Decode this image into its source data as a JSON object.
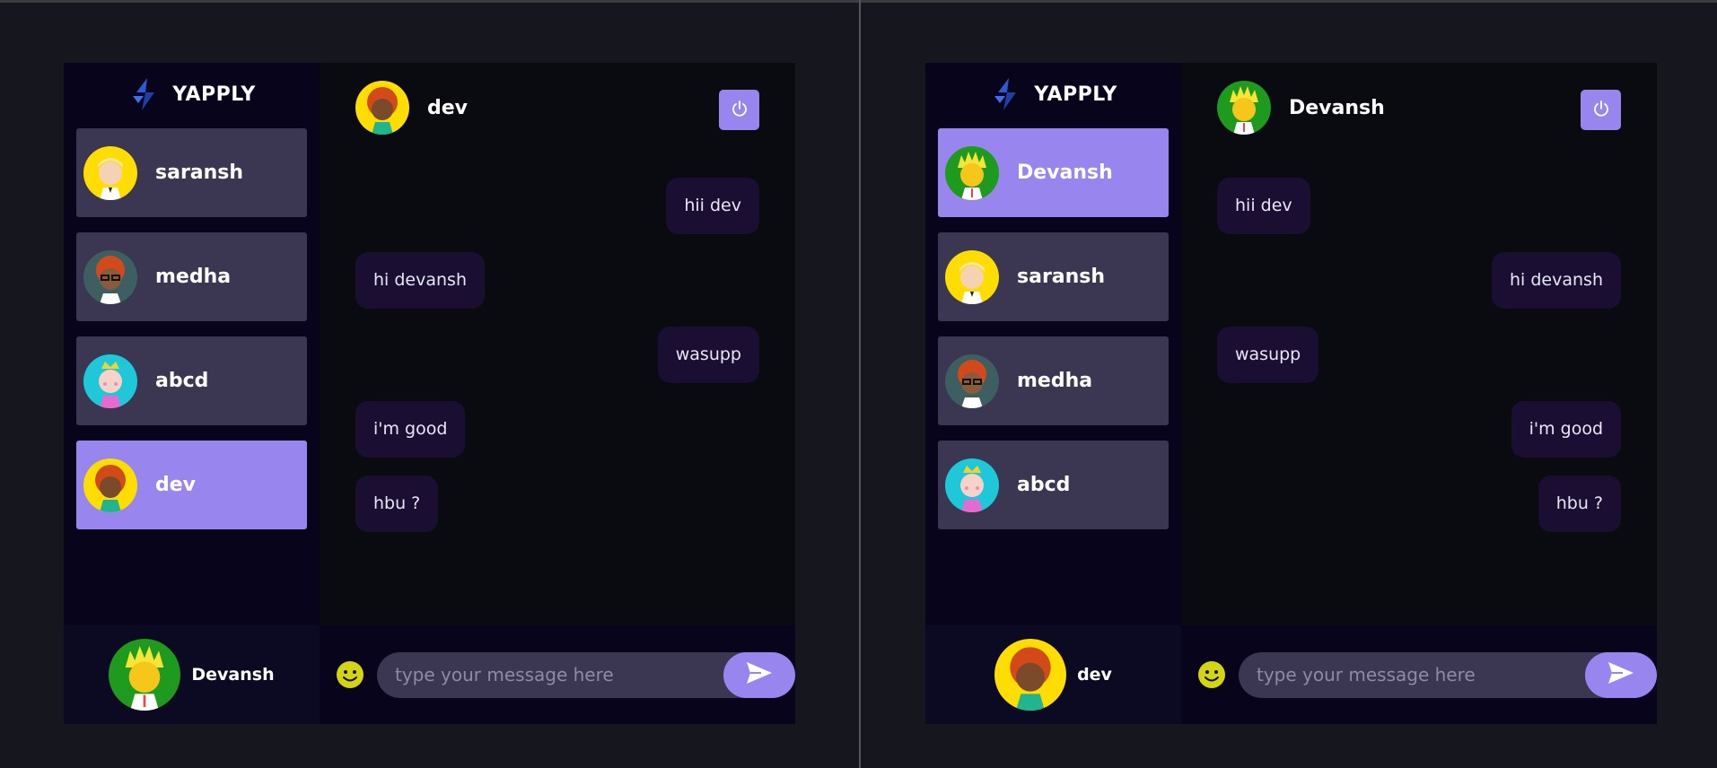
{
  "brand": {
    "name": "YAPPLY"
  },
  "left_window": {
    "contacts": [
      {
        "name": "saransh",
        "avatar": "blond-boy-avatar",
        "active": false
      },
      {
        "name": "medha",
        "avatar": "glasses-redhead-avatar",
        "active": false
      },
      {
        "name": "abcd",
        "avatar": "crowned-pink-avatar",
        "active": false
      },
      {
        "name": "dev",
        "avatar": "curly-red-hair-avatar",
        "active": true
      }
    ],
    "current_user": {
      "name": "Devansh"
    },
    "chat": {
      "title": "dev",
      "messages": [
        {
          "text": "hii dev",
          "direction": "out"
        },
        {
          "text": "hi devansh",
          "direction": "in"
        },
        {
          "text": "wasupp",
          "direction": "out"
        },
        {
          "text": "i'm good",
          "direction": "in"
        },
        {
          "text": "hbu ?",
          "direction": "in"
        }
      ],
      "input_placeholder": "type your message here"
    }
  },
  "right_window": {
    "contacts": [
      {
        "name": "Devansh",
        "avatar": "spiky-yellow-hair-avatar",
        "active": true
      },
      {
        "name": "saransh",
        "avatar": "blond-boy-avatar",
        "active": false
      },
      {
        "name": "medha",
        "avatar": "glasses-redhead-avatar",
        "active": false
      },
      {
        "name": "abcd",
        "avatar": "crowned-pink-avatar",
        "active": false
      }
    ],
    "current_user": {
      "name": "dev"
    },
    "chat": {
      "title": "Devansh",
      "messages": [
        {
          "text": "hii dev",
          "direction": "in"
        },
        {
          "text": "hi devansh",
          "direction": "out"
        },
        {
          "text": "wasupp",
          "direction": "in"
        },
        {
          "text": "i'm good",
          "direction": "out"
        },
        {
          "text": "hbu ?",
          "direction": "out"
        }
      ],
      "input_placeholder": "type your message here"
    }
  },
  "colors": {
    "accent": "#9886ee",
    "sidebar_bg": "#07041b",
    "contact_bg": "#3b3753",
    "chat_bg": "#0a0a11",
    "bubble_bg": "#1a0f33"
  },
  "icons": {
    "power": "power-icon",
    "send": "send-icon",
    "emoji": "smiley-icon",
    "logo": "yapply-logo-icon"
  }
}
